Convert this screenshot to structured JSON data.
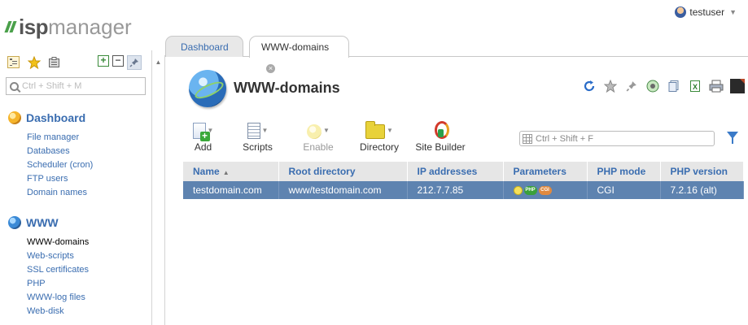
{
  "app": {
    "logo_isp": "isp",
    "logo_manager": "manager",
    "user_name": "testuser"
  },
  "sidebar": {
    "search_placeholder": "Ctrl + Shift + M",
    "groups": [
      {
        "title": "Dashboard",
        "icon": "dashboard-icon",
        "items": [
          "File manager",
          "Databases",
          "Scheduler (cron)",
          "FTP users",
          "Domain names"
        ]
      },
      {
        "title": "WWW",
        "icon": "globe-icon",
        "items": [
          "WWW-domains",
          "Web-scripts",
          "SSL certificates",
          "PHP",
          "WWW-log files",
          "Web-disk"
        ],
        "active_item": "WWW-domains"
      }
    ]
  },
  "tabs": [
    {
      "label": "Dashboard",
      "active": false
    },
    {
      "label": "WWW-domains",
      "active": true
    }
  ],
  "page": {
    "title": "WWW-domains",
    "icon": "globe-icon"
  },
  "header_icons": [
    "refresh-icon",
    "star-icon",
    "pin-icon",
    "network-icon",
    "copy-icon",
    "excel-icon",
    "print-icon",
    "dark-square-icon"
  ],
  "toolbar": {
    "buttons": [
      {
        "label": "Add",
        "icon": "add-icon",
        "dropdown": true,
        "disabled": false
      },
      {
        "label": "Scripts",
        "icon": "scripts-icon",
        "dropdown": true,
        "disabled": false
      },
      {
        "label": "Enable",
        "icon": "bulb-icon",
        "dropdown": true,
        "disabled": true
      },
      {
        "label": "Directory",
        "icon": "folder-icon",
        "dropdown": true,
        "disabled": false
      },
      {
        "label": "Site Builder",
        "icon": "site-builder-icon",
        "dropdown": false,
        "disabled": false
      }
    ],
    "search_placeholder": "Ctrl + Shift + F"
  },
  "table": {
    "columns": [
      "Name",
      "Root directory",
      "IP addresses",
      "Parameters",
      "PHP mode",
      "PHP version"
    ],
    "sort_column": "Name",
    "rows": [
      {
        "name": "testdomain.com",
        "root": "www/testdomain.com",
        "ip": "212.7.7.85",
        "parameters": [
          "bulb-icon",
          "php-icon",
          "cgi-icon"
        ],
        "php_mode": "CGI",
        "php_version": "7.2.16 (alt)",
        "selected": true
      }
    ]
  },
  "colors": {
    "accent": "#3a6db0",
    "selected_row": "#5e83b0",
    "header_bg": "#e6e6e6",
    "logo_green": "#4aa04a"
  }
}
